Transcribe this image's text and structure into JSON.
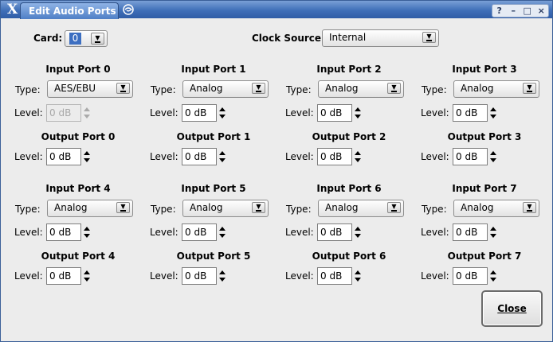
{
  "window": {
    "title": "Edit Audio Ports",
    "controls": {
      "help": "?",
      "minimize": "–",
      "maximize": "□",
      "close": "×"
    }
  },
  "card": {
    "label": "Card:",
    "value": "0"
  },
  "clock": {
    "label": "Clock Source:",
    "value": "Internal"
  },
  "labels": {
    "type": "Type:",
    "level": "Level:"
  },
  "input_ports": [
    {
      "title": "Input Port 0",
      "type": "AES/EBU",
      "level": "0 dB",
      "disabled": true
    },
    {
      "title": "Input Port 1",
      "type": "Analog",
      "level": "0 dB"
    },
    {
      "title": "Input Port 2",
      "type": "Analog",
      "level": "0 dB"
    },
    {
      "title": "Input Port 3",
      "type": "Analog",
      "level": "0 dB"
    },
    {
      "title": "Input Port 4",
      "type": "Analog",
      "level": "0 dB"
    },
    {
      "title": "Input Port 5",
      "type": "Analog",
      "level": "0 dB"
    },
    {
      "title": "Input Port 6",
      "type": "Analog",
      "level": "0 dB"
    },
    {
      "title": "Input Port 7",
      "type": "Analog",
      "level": "0 dB"
    }
  ],
  "output_ports": [
    {
      "title": "Output Port 0",
      "level": "0 dB"
    },
    {
      "title": "Output Port 1",
      "level": "0 dB"
    },
    {
      "title": "Output Port 2",
      "level": "0 dB"
    },
    {
      "title": "Output Port 3",
      "level": "0 dB"
    },
    {
      "title": "Output Port 4",
      "level": "0 dB"
    },
    {
      "title": "Output Port 5",
      "level": "0 dB"
    },
    {
      "title": "Output Port 6",
      "level": "0 dB"
    },
    {
      "title": "Output Port 7",
      "level": "0 dB"
    }
  ],
  "close_button": {
    "label": "Close"
  }
}
